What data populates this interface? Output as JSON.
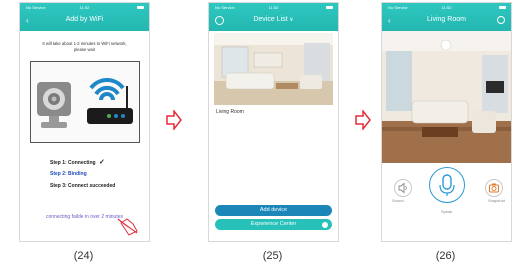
{
  "colors": {
    "teal": "#2ec8c0",
    "blue": "#1e88c8",
    "arrow": "#e0303c"
  },
  "status": {
    "carrier": "No Service",
    "time": "11:52"
  },
  "screen1": {
    "title": "Add by WiFi",
    "info_line1": "It will take about 1-2 minutes to WiFi network,",
    "info_line2": "please wait",
    "step1": "Step 1: Connecting",
    "step2": "Step 2: Binding",
    "step3": "Step 3: Connect succeeded",
    "fail_text": "connecting failde in over 2 minutes",
    "caption": "(24)"
  },
  "screen2": {
    "title": "Device List",
    "device_name": "Living Room",
    "add_button": "Add device",
    "experience_button": "Experience Center",
    "caption": "(25)"
  },
  "screen3": {
    "title": "Living Room",
    "sound_label": "Sound",
    "speak_label": "Speak",
    "snapshot_label": "Snapshot",
    "caption": "(26)"
  }
}
